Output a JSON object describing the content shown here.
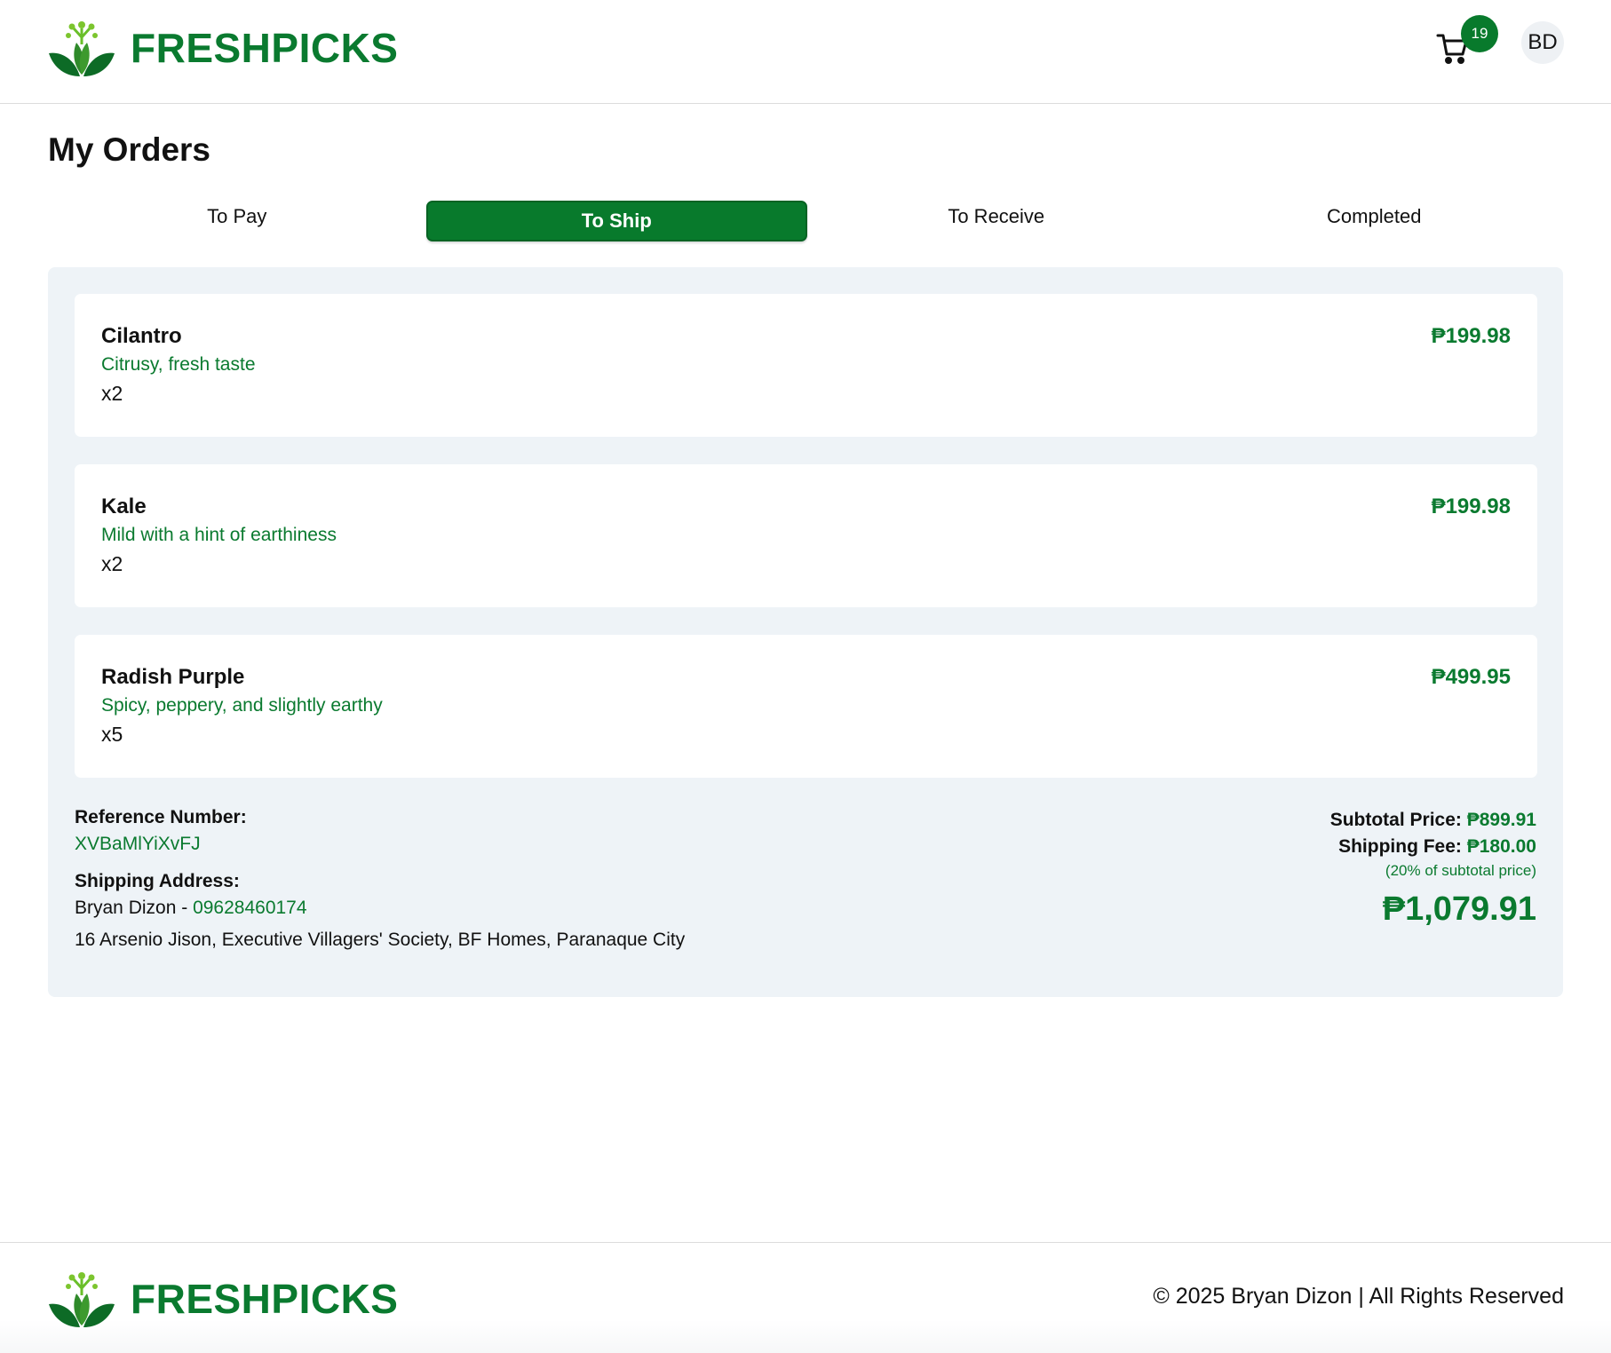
{
  "header": {
    "brand_name": "FRESHPICKS",
    "cart_count": "19",
    "avatar_initials": "BD"
  },
  "page": {
    "title": "My Orders"
  },
  "tabs": [
    {
      "label": "To Pay",
      "active": false
    },
    {
      "label": "To Ship",
      "active": true
    },
    {
      "label": "To Receive",
      "active": false
    },
    {
      "label": "Completed",
      "active": false
    }
  ],
  "order": {
    "items": [
      {
        "name": "Cilantro",
        "description": "Citrusy, fresh taste",
        "quantity": "x2",
        "price": "₱199.98"
      },
      {
        "name": "Kale",
        "description": "Mild with a hint of earthiness",
        "quantity": "x2",
        "price": "₱199.98"
      },
      {
        "name": "Radish Purple",
        "description": "Spicy, peppery, and slightly earthy",
        "quantity": "x5",
        "price": "₱499.95"
      }
    ],
    "reference_label": "Reference Number:",
    "reference_number": "XVBaMlYiXvFJ",
    "shipping_label": "Shipping Address:",
    "recipient_name": "Bryan Dizon -",
    "recipient_phone": "09628460174",
    "address": "16 Arsenio Jison, Executive Villagers' Society, BF Homes, Paranaque City",
    "subtotal_label": "Subtotal Price:",
    "subtotal_amount": "₱899.91",
    "shipping_fee_label": "Shipping Fee:",
    "shipping_fee_amount": "₱180.00",
    "shipping_fee_note": "(20% of subtotal price)",
    "grand_total": "₱1,079.91"
  },
  "footer": {
    "brand_name": "FRESHPICKS",
    "copyright": "© 2025 Bryan Dizon | All Rights Reserved"
  },
  "colors": {
    "brand_green": "#0a7a2f",
    "panel_background": "#eef3f7",
    "active_tab": "#087a2c"
  },
  "icons": [
    "leaf-logo-icon",
    "cart-icon"
  ]
}
